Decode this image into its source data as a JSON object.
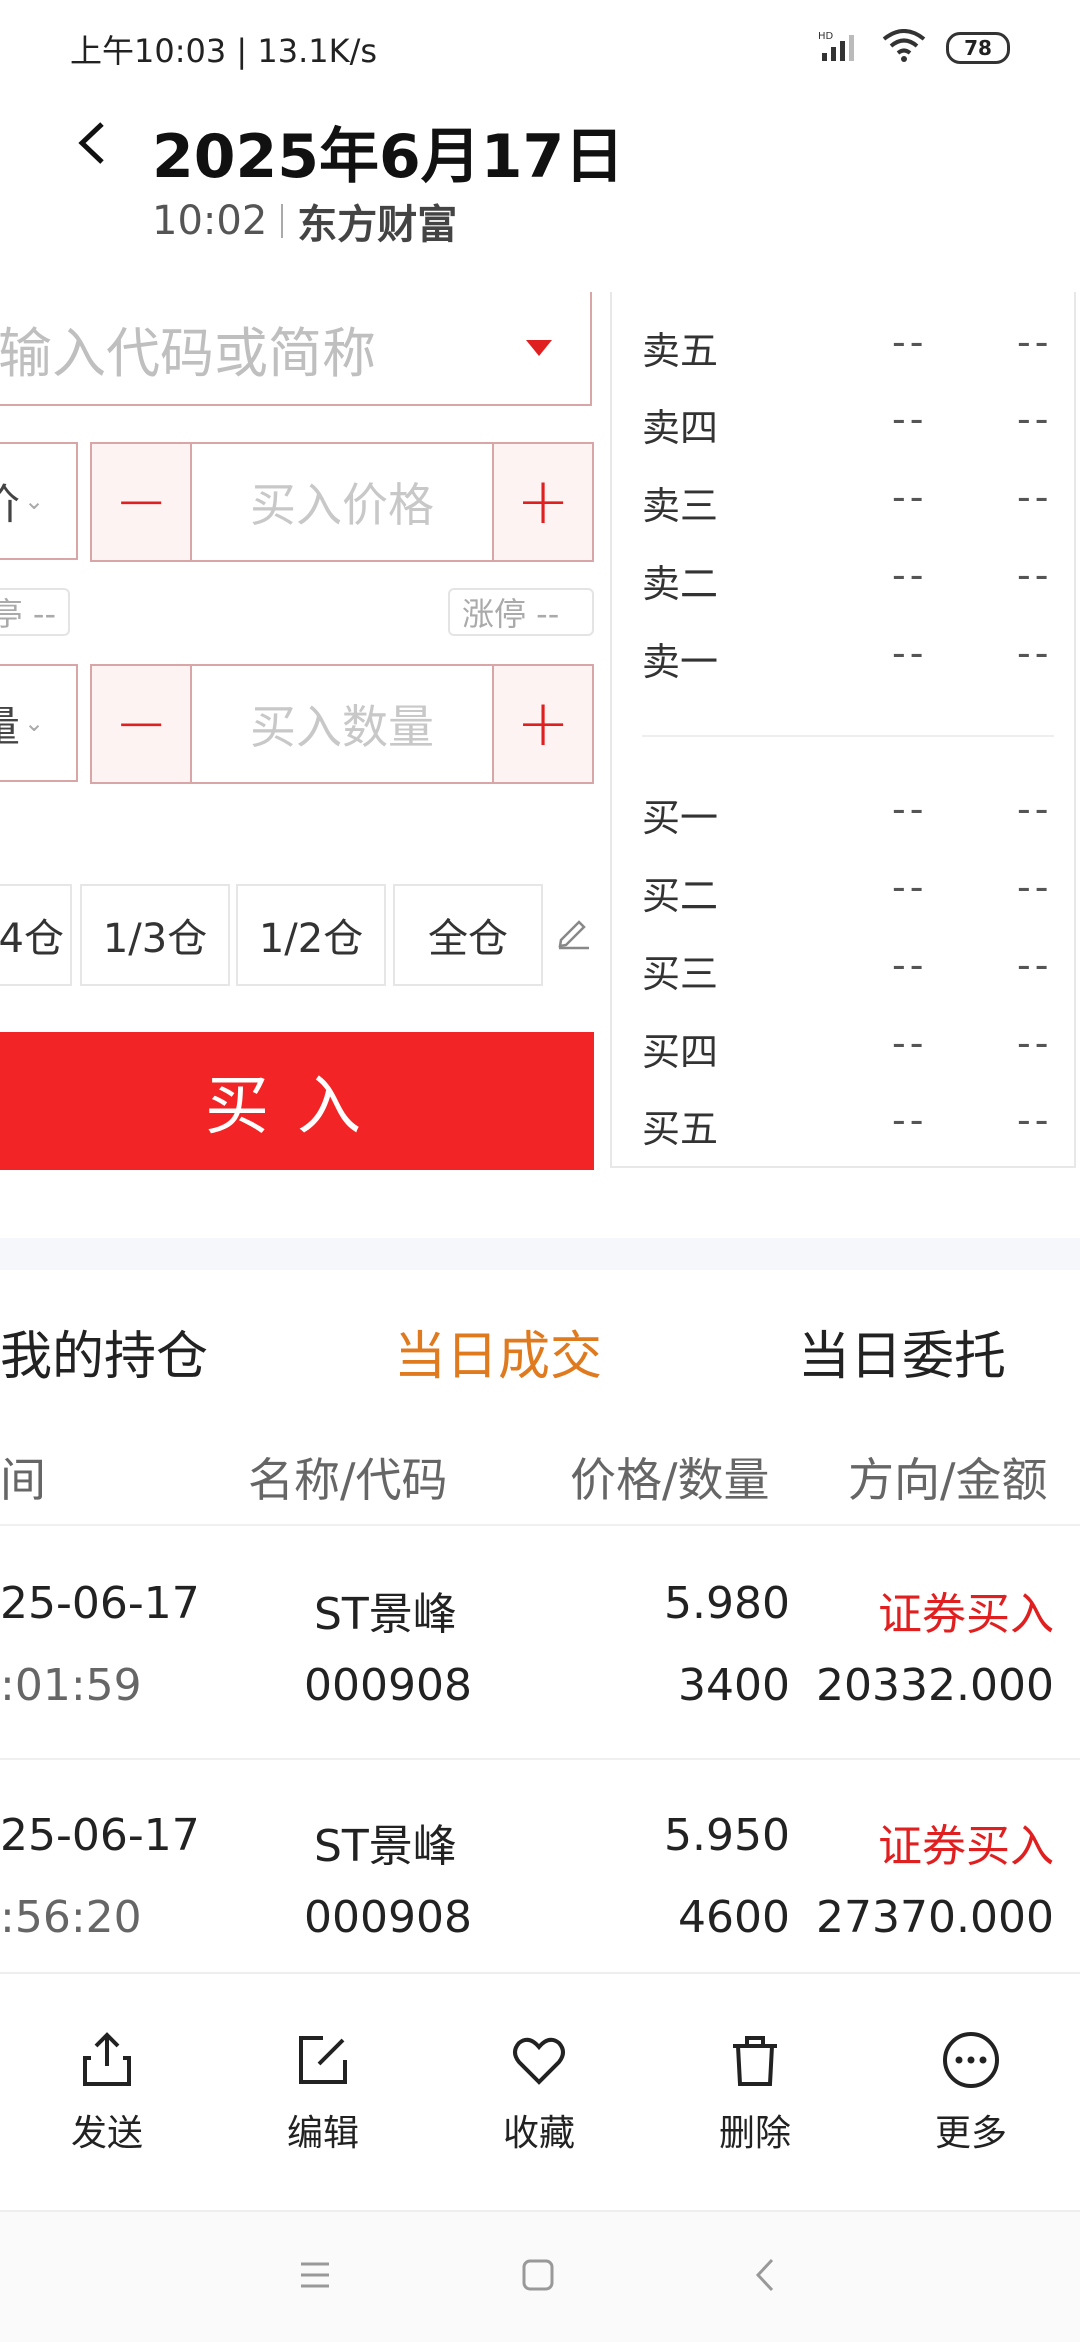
{
  "status_bar": {
    "time_speed": "上午10:03 | 13.1K/s",
    "network_label": "HD",
    "battery": "78"
  },
  "header": {
    "date": "2025年6月17日",
    "time": "10:02",
    "broker": "东方财富"
  },
  "order_form": {
    "code_placeholder": "输入代码或简称",
    "price_type_partial": "价",
    "price_placeholder": "买入价格",
    "limit_down_partial": "亭 --",
    "limit_up": "涨停 --",
    "qty_type_partial": "量",
    "qty_placeholder": "买入数量",
    "position_buttons": [
      "4仓",
      "1/3仓",
      "1/2仓",
      "全仓"
    ],
    "buy_label": "买入"
  },
  "order_book": {
    "sell": [
      {
        "label": "卖五",
        "price": "--",
        "volume": "--"
      },
      {
        "label": "卖四",
        "price": "--",
        "volume": "--"
      },
      {
        "label": "卖三",
        "price": "--",
        "volume": "--"
      },
      {
        "label": "卖二",
        "price": "--",
        "volume": "--"
      },
      {
        "label": "卖一",
        "price": "--",
        "volume": "--"
      }
    ],
    "buy": [
      {
        "label": "买一",
        "price": "--",
        "volume": "--"
      },
      {
        "label": "买二",
        "price": "--",
        "volume": "--"
      },
      {
        "label": "买三",
        "price": "--",
        "volume": "--"
      },
      {
        "label": "买四",
        "price": "--",
        "volume": "--"
      },
      {
        "label": "买五",
        "price": "--",
        "volume": "--"
      }
    ]
  },
  "tabs": [
    "我的持仓",
    "当日成交",
    "当日委托"
  ],
  "active_tab": "当日成交",
  "table": {
    "headers": [
      "间",
      "名称/代码",
      "价格/数量",
      "方向/金额"
    ],
    "rows": [
      {
        "date": "25-06-17",
        "time": ":01:59",
        "name": "ST景峰",
        "code": "000908",
        "price": "5.980",
        "qty": "3400",
        "direction": "证券买入",
        "amount": "20332.000"
      },
      {
        "date": "25-06-17",
        "time": ":56:20",
        "name": "ST景峰",
        "code": "000908",
        "price": "5.950",
        "qty": "4600",
        "direction": "证券买入",
        "amount": "27370.000"
      }
    ]
  },
  "actions": [
    {
      "label": "发送",
      "icon": "share-icon"
    },
    {
      "label": "编辑",
      "icon": "edit-icon"
    },
    {
      "label": "收藏",
      "icon": "heart-icon"
    },
    {
      "label": "删除",
      "icon": "trash-icon"
    },
    {
      "label": "更多",
      "icon": "more-icon"
    }
  ],
  "colors": {
    "accent_red": "#f22425",
    "active_tab": "#e07a1f",
    "direction_red": "#e02020"
  }
}
